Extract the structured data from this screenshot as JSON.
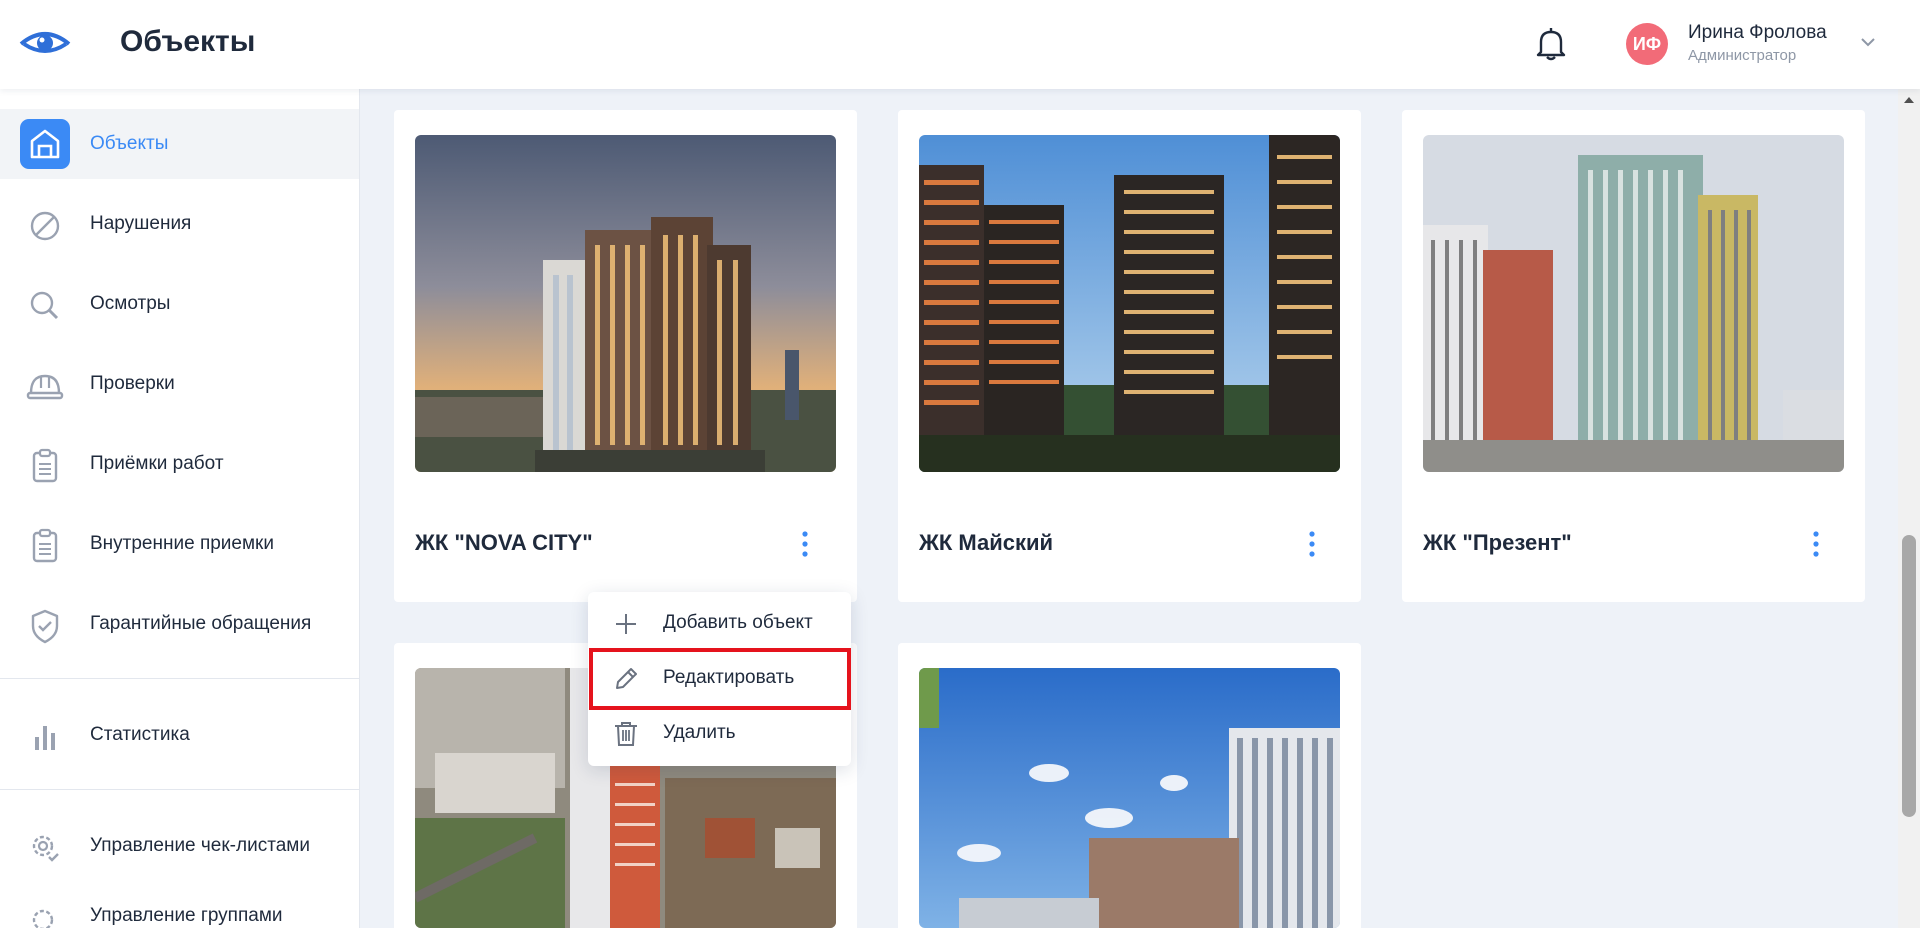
{
  "header": {
    "title": "Объекты",
    "user": {
      "initials": "ИФ",
      "name": "Ирина Фролова",
      "role": "Администратор"
    }
  },
  "sidebar": {
    "items": [
      {
        "label": "Объекты",
        "icon": "building-icon",
        "active": true
      },
      {
        "label": "Нарушения",
        "icon": "prohibited-icon"
      },
      {
        "label": "Осмотры",
        "icon": "magnifier-icon"
      },
      {
        "label": "Проверки",
        "icon": "hard-hat-icon"
      },
      {
        "label": "Приёмки работ",
        "icon": "clipboard-icon"
      },
      {
        "label": "Внутренние приемки",
        "icon": "clipboard-icon"
      },
      {
        "label": "Гарантийные обращения",
        "icon": "shield-check-icon"
      },
      {
        "label": "Статистика",
        "icon": "bar-chart-icon"
      },
      {
        "label": "Управление чек-листами",
        "icon": "gear-check-icon"
      },
      {
        "label": "Управление группами",
        "icon": "gear-icon"
      }
    ]
  },
  "cards": [
    {
      "title": "ЖК \"NOVA CITY\""
    },
    {
      "title": "ЖК Майский"
    },
    {
      "title": "ЖК \"Презент\""
    },
    {
      "title": ""
    },
    {
      "title": ""
    }
  ],
  "context_menu": {
    "items": [
      {
        "label": "Добавить объект",
        "icon": "plus-icon"
      },
      {
        "label": "Редактировать",
        "icon": "pencil-icon"
      },
      {
        "label": "Удалить",
        "icon": "trash-icon"
      }
    ]
  },
  "colors": {
    "accent": "#3b8af5",
    "avatar": "#f26b78",
    "highlight": "#e5131d",
    "text": "#1f2a3c"
  }
}
